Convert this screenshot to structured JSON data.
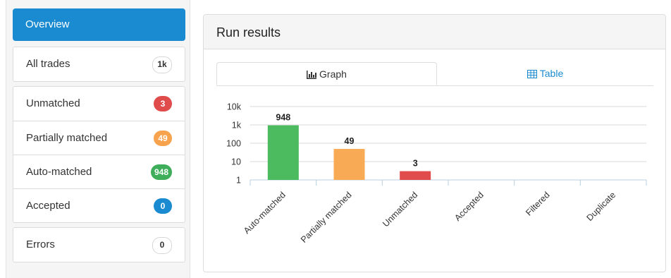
{
  "sidebar": {
    "overview_label": "Overview",
    "items": [
      {
        "label": "All trades",
        "badge": "1k",
        "badge_color": "#ffffff"
      },
      {
        "label": "Unmatched",
        "badge": "3",
        "badge_color": "#e04b4b"
      },
      {
        "label": "Partially matched",
        "badge": "49",
        "badge_color": "#f7a24d"
      },
      {
        "label": "Auto-matched",
        "badge": "948",
        "badge_color": "#3fae5a"
      },
      {
        "label": "Accepted",
        "badge": "0",
        "badge_color": "#1a8bd0"
      },
      {
        "label": "Errors",
        "badge": "0",
        "badge_color": "#ffffff"
      }
    ]
  },
  "panel": {
    "title": "Run results",
    "tabs": [
      {
        "label": "Graph",
        "icon": "bar-chart-icon",
        "active": true
      },
      {
        "label": "Table",
        "icon": "table-icon",
        "active": false
      }
    ]
  },
  "chart_data": {
    "type": "bar",
    "yscale": "log",
    "ylim": [
      1,
      10000
    ],
    "yticks": [
      "1",
      "10",
      "100",
      "1k",
      "10k"
    ],
    "categories": [
      "Auto-matched",
      "Partially matched",
      "Unmatched",
      "Accepted",
      "Filtered",
      "Duplicate"
    ],
    "values": [
      948,
      49,
      3,
      0,
      0,
      0
    ],
    "labels": [
      "948",
      "49",
      "3",
      "",
      "",
      ""
    ],
    "colors": [
      "#4cba5e",
      "#f9aa55",
      "#e04b4b",
      "#1a8bd0",
      "#999999",
      "#999999"
    ],
    "grid": true
  }
}
